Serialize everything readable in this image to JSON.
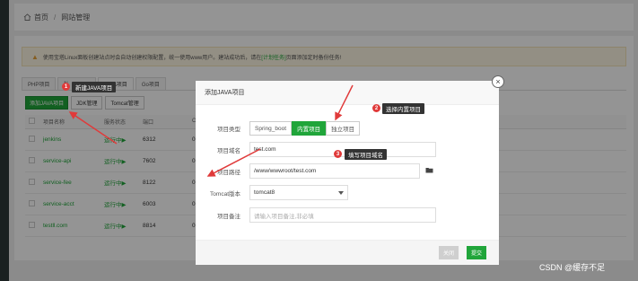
{
  "breadcrumb": {
    "home": "首页",
    "separator": "/",
    "current": "网站管理"
  },
  "notice": {
    "text_before": "使用宝塔Linux面板创建站点时会自动创建权限配置，统一使用www用户。建站成功后，请在",
    "link": "[计划任务]",
    "text_after": "页面添加定时备份任务!"
  },
  "tabs": [
    "PHP项目",
    "N",
    "JAVA项目",
    "Go项目"
  ],
  "toolbar": {
    "add_java": "添加JAVA项目",
    "jdk": "JDK管理",
    "tomcat": "Tomcat管理"
  },
  "table": {
    "headers": [
      "项目名称",
      "服务状态",
      "端口",
      "CPU"
    ],
    "rows": [
      {
        "name": "jenkins",
        "status": "运行中▶",
        "port": "6312",
        "cpu": "0.0"
      },
      {
        "name": "service-api",
        "status": "运行中▶",
        "port": "7602",
        "cpu": "0.0"
      },
      {
        "name": "service-fee",
        "status": "运行中▶",
        "port": "8122",
        "cpu": "0.2"
      },
      {
        "name": "service-acct",
        "status": "运行中▶",
        "port": "6003",
        "cpu": "0.2"
      },
      {
        "name": "testll.com",
        "status": "运行中▶",
        "port": "8814",
        "cpu": "0.0"
      }
    ]
  },
  "modal": {
    "title": "添加JAVA项目",
    "close_glyph": "×",
    "project_type_label": "项目类型",
    "project_types": [
      "Spring_boot",
      "内置项目",
      "独立项目"
    ],
    "project_domain_label": "项目域名",
    "project_domain_value": "test.com",
    "project_path_label": "项目路径",
    "project_path_value": "/www/wwwroot/test.com",
    "tomcat_version_label": "Tomcat版本",
    "tomcat_version_value": "tomcat8",
    "remark_label": "项目备注",
    "remark_placeholder": "请输入项目备注,非必填",
    "btn_close": "关闭",
    "btn_submit": "提交"
  },
  "annotations": [
    {
      "num": "1",
      "text": "新建JAVA项目"
    },
    {
      "num": "2",
      "text": "选择内置项目"
    },
    {
      "num": "3",
      "text": "填写项目域名"
    }
  ],
  "watermark": "CSDN @缓存不足",
  "colors": {
    "accent_green": "#20a53a",
    "annotation_red": "#e03a3a"
  },
  "icons": {
    "home": "home-icon",
    "warning": "warning-icon",
    "folder": "folder-icon",
    "dropdown": "chevron-down-icon"
  }
}
